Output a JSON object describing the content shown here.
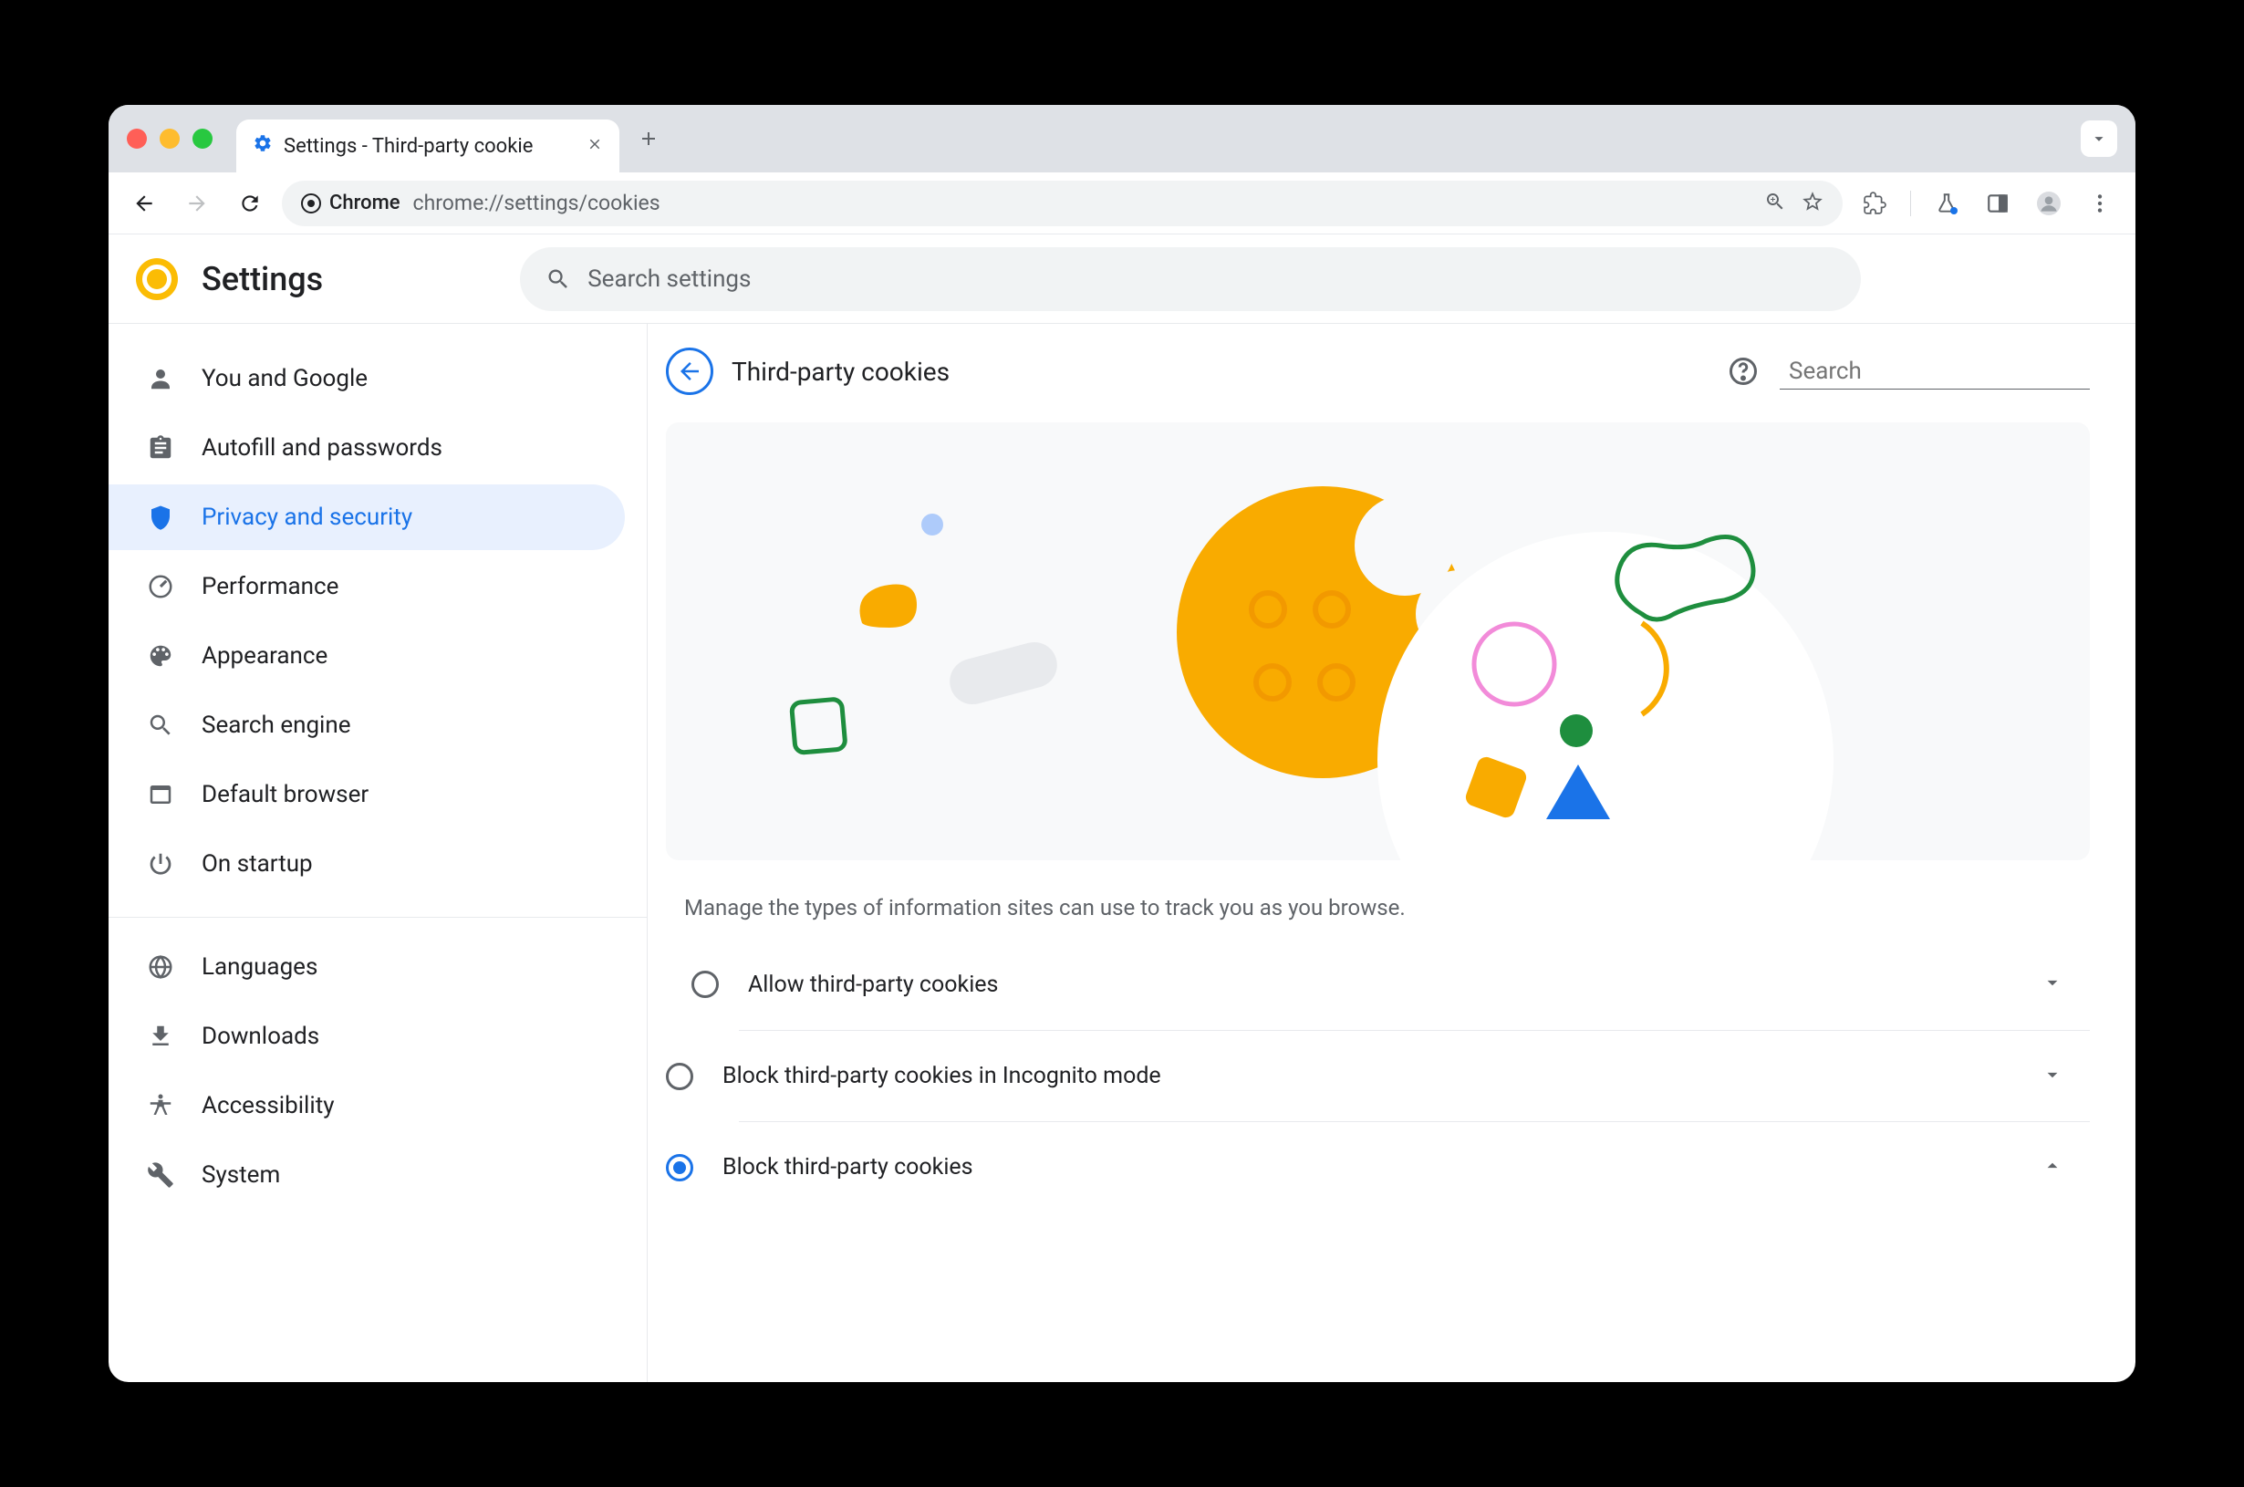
{
  "tab": {
    "title": "Settings - Third-party cookie"
  },
  "omnibox": {
    "chip": "Chrome",
    "url": "chrome://settings/cookies"
  },
  "header": {
    "title": "Settings",
    "search_placeholder": "Search settings"
  },
  "sidebar": {
    "items": [
      {
        "label": "You and Google"
      },
      {
        "label": "Autofill and passwords"
      },
      {
        "label": "Privacy and security"
      },
      {
        "label": "Performance"
      },
      {
        "label": "Appearance"
      },
      {
        "label": "Search engine"
      },
      {
        "label": "Default browser"
      },
      {
        "label": "On startup"
      }
    ],
    "items2": [
      {
        "label": "Languages"
      },
      {
        "label": "Downloads"
      },
      {
        "label": "Accessibility"
      },
      {
        "label": "System"
      }
    ]
  },
  "page": {
    "title": "Third-party cookies",
    "search_placeholder": "Search",
    "description": "Manage the types of information sites can use to track you as you browse.",
    "options": [
      {
        "label": "Allow third-party cookies",
        "checked": false,
        "expanded": false
      },
      {
        "label": "Block third-party cookies in Incognito mode",
        "checked": false,
        "expanded": false
      },
      {
        "label": "Block third-party cookies",
        "checked": true,
        "expanded": true
      }
    ]
  }
}
